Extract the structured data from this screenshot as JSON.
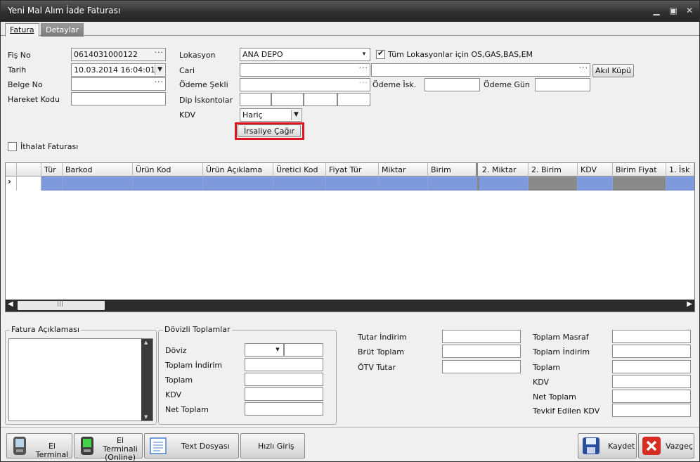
{
  "window": {
    "title": "Yeni Mal Alım İade Faturası"
  },
  "tabs": [
    {
      "label": "Fatura"
    },
    {
      "label": "Detaylar"
    }
  ],
  "form": {
    "fis_no_label": "Fiş No",
    "fis_no": "0614031000122",
    "tarih_label": "Tarih",
    "tarih": "10.03.2014 16:04:01",
    "belge_no_label": "Belge No",
    "belge_no": "",
    "hareket_kodu_label": "Hareket Kodu",
    "hareket_kodu": "",
    "lokasyon_label": "Lokasyon",
    "lokasyon": "ANA DEPO",
    "tum_lokasyonlar_label": "Tüm Lokasyonlar için OS,GAS,BAS,EM",
    "tum_lokasyonlar_checked": true,
    "cari_label": "Cari",
    "cari": "",
    "cari2": "",
    "akil_kupu": "Akıl Küpü",
    "odeme_sekli_label": "Ödeme Şekli",
    "odeme_sekli": "",
    "odeme_isk_label": "Ödeme İsk.",
    "odeme_isk": "",
    "odeme_gun_label": "Ödeme Gün",
    "odeme_gun": "",
    "dip_iskontolar_label": "Dip İskontolar",
    "kdv_label": "KDV",
    "kdv": "Hariç",
    "irsaliye_cagir": "İrsaliye Çağır",
    "ithalat_label": "İthalat Faturası",
    "ithalat_checked": false
  },
  "grid": {
    "columns": [
      "Tür",
      "Barkod",
      "Ürün Kod",
      "Ürün Açıklama",
      "Üretici Kod",
      "Fiyat Tür",
      "Miktar",
      "Birim",
      "2. Miktar",
      "2. Birim",
      "KDV",
      "Birim Fiyat",
      "1. İsk"
    ],
    "row_indicator": "›"
  },
  "bottom": {
    "fatura_aciklamasi": "Fatura Açıklaması",
    "dovizli_toplamlar": "Dövizli Toplamlar",
    "doviz": "Döviz",
    "toplam_indirim": "Toplam İndirim",
    "toplam": "Toplam",
    "kdv": "KDV",
    "net_toplam": "Net Toplam",
    "tutar_indirim": "Tutar İndirim",
    "brut_toplam": "Brüt Toplam",
    "otv_tutar": "ÖTV Tutar",
    "toplam_masraf": "Toplam Masraf",
    "toplam_indirim_r": "Toplam İndirim",
    "toplam_r": "Toplam",
    "kdv_r": "KDV",
    "net_toplam_r": "Net Toplam",
    "tevkif": "Tevkif Edilen KDV"
  },
  "toolbar": {
    "el_terminal": "El Terminal",
    "el_terminali_online_1": "El Terminali",
    "el_terminali_online_2": "(Online)",
    "text_dosyasi": "Text Dosyası",
    "hizli_giris": "Hızlı Giriş",
    "kaydet": "Kaydet",
    "vazgec": "Vazgeç"
  }
}
